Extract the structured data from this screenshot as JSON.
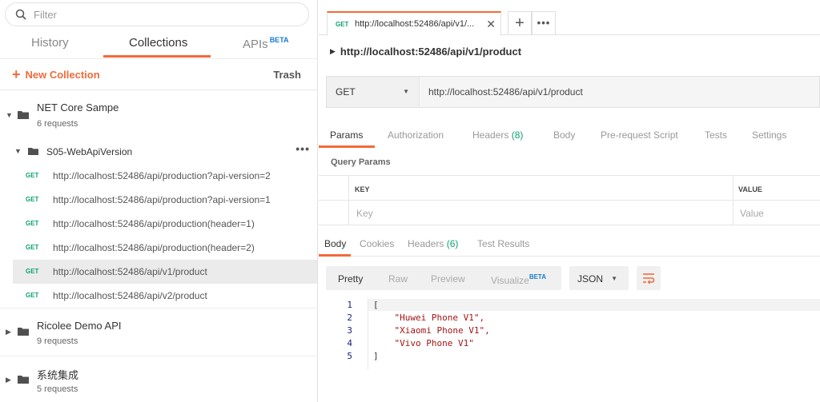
{
  "sidebar": {
    "filter_placeholder": "Filter",
    "tabs": [
      {
        "label": "History"
      },
      {
        "label": "Collections"
      },
      {
        "label": "APIs",
        "badge": "BETA"
      }
    ],
    "new_collection": "New Collection",
    "trash": "Trash",
    "collections": [
      {
        "name": "NET Core Sampe",
        "count": "6 requests"
      },
      {
        "name": "Ricolee Demo API",
        "count": "9 requests"
      },
      {
        "name": "系统集成",
        "count": "5 requests"
      }
    ],
    "folder": {
      "name": "S05-WebApiVersion",
      "more": "•••",
      "requests": [
        {
          "method": "GET",
          "url": "http://localhost:52486/api/production?api-version=2"
        },
        {
          "method": "GET",
          "url": "http://localhost:52486/api/production?api-version=1"
        },
        {
          "method": "GET",
          "url": "http://localhost:52486/api/production(header=1)"
        },
        {
          "method": "GET",
          "url": "http://localhost:52486/api/production(header=2)"
        },
        {
          "method": "GET",
          "url": "http://localhost:52486/api/v1/product"
        },
        {
          "method": "GET",
          "url": "http://localhost:52486/api/v2/product"
        }
      ]
    }
  },
  "main": {
    "tab": {
      "method": "GET",
      "label": "http://localhost:52486/api/v1/...",
      "close": "✕"
    },
    "tab_more": "•••",
    "request_title": "http://localhost:52486/api/v1/product",
    "method": "GET",
    "url": "http://localhost:52486/api/v1/product",
    "request_tabs": [
      {
        "label": "Params"
      },
      {
        "label": "Authorization"
      },
      {
        "label": "Headers",
        "count": "(8)"
      },
      {
        "label": "Body"
      },
      {
        "label": "Pre-request Script"
      },
      {
        "label": "Tests"
      },
      {
        "label": "Settings"
      }
    ],
    "query_params": {
      "title": "Query Params",
      "key_header": "KEY",
      "value_header": "VALUE",
      "key_placeholder": "Key",
      "value_placeholder": "Value"
    },
    "response_tabs": [
      {
        "label": "Body"
      },
      {
        "label": "Cookies"
      },
      {
        "label": "Headers",
        "count": "(6)"
      },
      {
        "label": "Test Results"
      }
    ],
    "format_buttons": [
      {
        "label": "Pretty"
      },
      {
        "label": "Raw"
      },
      {
        "label": "Preview"
      },
      {
        "label": "Visualize",
        "badge": "BETA"
      }
    ],
    "format": "JSON",
    "code_lines": [
      {
        "n": "1",
        "text": "["
      },
      {
        "n": "2",
        "text": "    \"Huwei Phone V1\","
      },
      {
        "n": "3",
        "text": "    \"Xiaomi Phone V1\","
      },
      {
        "n": "4",
        "text": "    \"Vivo Phone V1\""
      },
      {
        "n": "5",
        "text": "]"
      }
    ]
  },
  "colors": {
    "accent": "#f26b3a",
    "get_method": "#0ca36c",
    "beta": "#1a7bd0",
    "string": "#a31515"
  }
}
